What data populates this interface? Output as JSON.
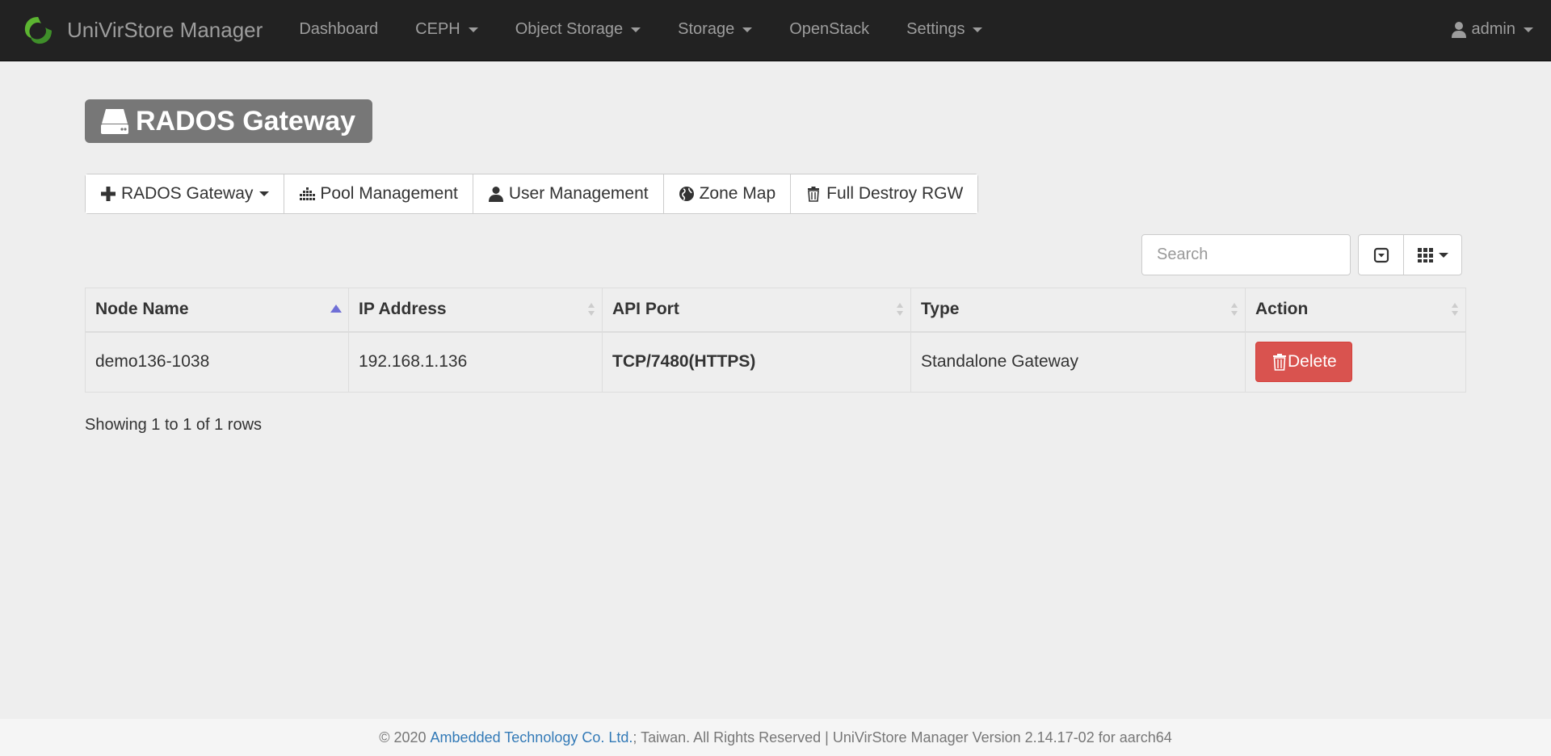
{
  "navbar": {
    "brand": "UniVirStore Manager",
    "items": [
      {
        "label": "Dashboard",
        "dropdown": false
      },
      {
        "label": "CEPH",
        "dropdown": true
      },
      {
        "label": "Object Storage",
        "dropdown": true
      },
      {
        "label": "Storage",
        "dropdown": true
      },
      {
        "label": "OpenStack",
        "dropdown": false
      },
      {
        "label": "Settings",
        "dropdown": true
      }
    ],
    "user": "admin"
  },
  "page": {
    "title": "RADOS Gateway"
  },
  "toolbar": {
    "rados_gateway": "RADOS Gateway",
    "pool_management": "Pool Management",
    "user_management": "User Management",
    "zone_map": "Zone Map",
    "full_destroy": "Full Destroy RGW"
  },
  "search": {
    "placeholder": "Search"
  },
  "table": {
    "columns": [
      "Node Name",
      "IP Address",
      "API Port",
      "Type",
      "Action"
    ],
    "rows": [
      {
        "node_name": "demo136-1038",
        "ip": "192.168.1.136",
        "api_port": "TCP/7480(HTTPS)",
        "type": "Standalone Gateway",
        "action": "Delete"
      }
    ]
  },
  "pagination": {
    "info": "Showing 1 to 1 of 1 rows"
  },
  "footer": {
    "prefix": "© 2020 ",
    "company": "Ambedded Technology Co. Ltd.",
    "suffix": "; Taiwan. All Rights Reserved | UniVirStore Manager Version 2.14.17-02 for aarch64"
  },
  "colors": {
    "navbar": "#222222",
    "danger": "#d9534f",
    "title_bg": "#777777",
    "link": "#337ab7",
    "brand_green": "#5cb531"
  }
}
